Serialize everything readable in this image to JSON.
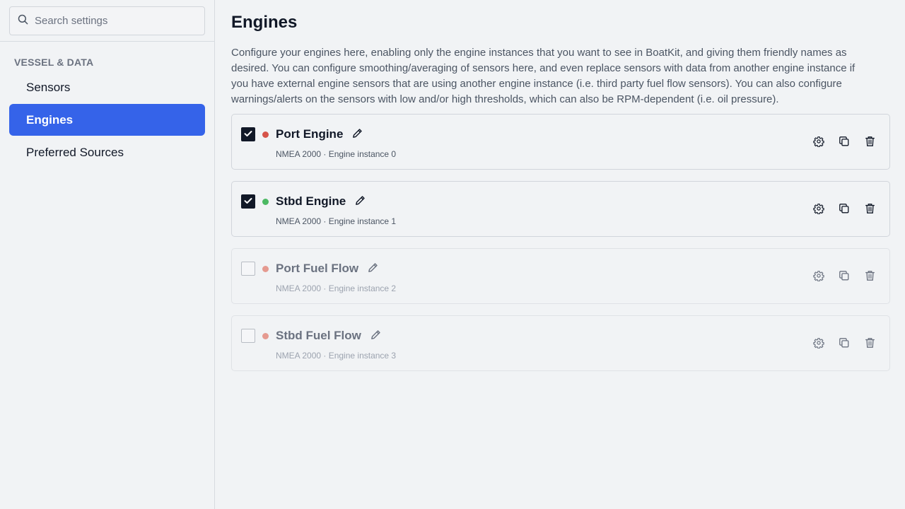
{
  "search": {
    "placeholder": "Search settings",
    "value": ""
  },
  "sidebar": {
    "section_title": "VESSEL & DATA",
    "items": [
      {
        "label": "Sensors",
        "active": false
      },
      {
        "label": "Engines",
        "active": true
      },
      {
        "label": "Preferred Sources",
        "active": false
      }
    ]
  },
  "main": {
    "title": "Engines",
    "description": "Configure your engines here, enabling only the engine instances that you want to see in BoatKit, and giving them friendly names as desired. You can configure smoothing/averaging of sensors here, and even replace sensors with data from another engine instance if you have external engine sensors that are using another engine instance (i.e. third party fuel flow sensors). You can also configure warnings/alerts on the sensors with low and/or high thresholds, which can also be RPM-dependent (i.e. oil pressure).",
    "engines": [
      {
        "name": "Port Engine",
        "subtitle": "NMEA 2000 · Engine instance 0",
        "enabled": true,
        "status_color": "#d6544a"
      },
      {
        "name": "Stbd Engine",
        "subtitle": "NMEA 2000 · Engine instance 1",
        "enabled": true,
        "status_color": "#4cb963"
      },
      {
        "name": "Port Fuel Flow",
        "subtitle": "NMEA 2000 · Engine instance 2",
        "enabled": false,
        "status_color": "#e59a90"
      },
      {
        "name": "Stbd Fuel Flow",
        "subtitle": "NMEA 2000 · Engine instance 3",
        "enabled": false,
        "status_color": "#e59a90"
      }
    ]
  },
  "colors": {
    "accent": "#3563e9",
    "checkbox_checked": "#111827"
  },
  "icons": {
    "search": "search-icon",
    "check": "check-icon",
    "edit": "pencil-icon",
    "settings": "gear-icon",
    "duplicate": "copy-icon",
    "delete": "trash-icon"
  }
}
